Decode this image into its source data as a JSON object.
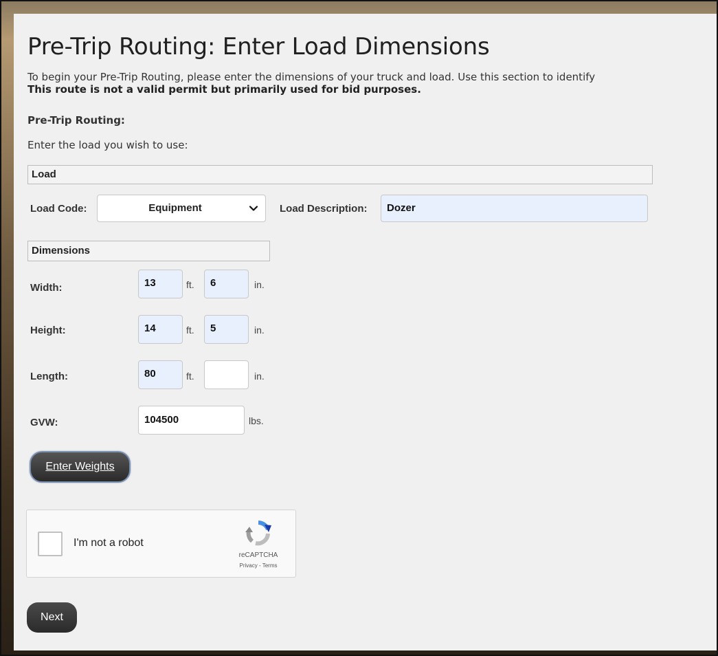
{
  "page": {
    "title": "Pre-Trip Routing: Enter Load Dimensions",
    "intro": "To begin your Pre-Trip Routing, please enter the dimensions of your truck and load. Use this section to identify",
    "intro_bold": "This route is not a valid permit but primarily used for bid purposes.",
    "section_label": "Pre-Trip Routing:",
    "prompt": "Enter the load you wish to use:"
  },
  "load": {
    "header": "Load",
    "code_label": "Load Code:",
    "code_value": "Equipment",
    "description_label": "Load Description:",
    "description_value": "Dozer"
  },
  "dimensions": {
    "header": "Dimensions",
    "width": {
      "label": "Width:",
      "ft": "13",
      "in": "6"
    },
    "height": {
      "label": "Height:",
      "ft": "14",
      "in": "5"
    },
    "length": {
      "label": "Length:",
      "ft": "80",
      "in": ""
    },
    "gvw": {
      "label": "GVW:",
      "value": "104500"
    },
    "unit_ft": "ft.",
    "unit_in": "in.",
    "unit_lbs": "lbs."
  },
  "buttons": {
    "enter_weights": "Enter Weights",
    "next": "Next"
  },
  "captcha": {
    "label": "I'm not a robot",
    "brand": "reCAPTCHA",
    "links": "Privacy - Terms"
  },
  "icons": {
    "select_arrow": "chevron-down-icon",
    "captcha_logo": "recaptcha-icon"
  },
  "colors": {
    "panel_bg": "#f0f0f0",
    "autofill_bg": "#e8f0fe",
    "button_bg": "#2a2a2a"
  }
}
